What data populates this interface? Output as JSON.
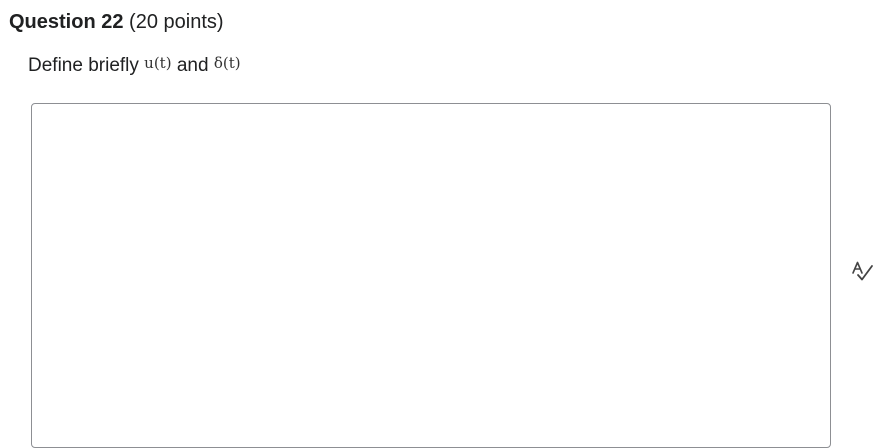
{
  "question": {
    "number_label": "Question 22",
    "points_label": "(20 points)",
    "prompt_prefix": "Define briefly",
    "math_u": "u(t)",
    "prompt_connector": "and",
    "math_delta": "δ(t)"
  },
  "answer": {
    "value": ""
  },
  "icons": {
    "spellcheck": "spellcheck-icon"
  }
}
